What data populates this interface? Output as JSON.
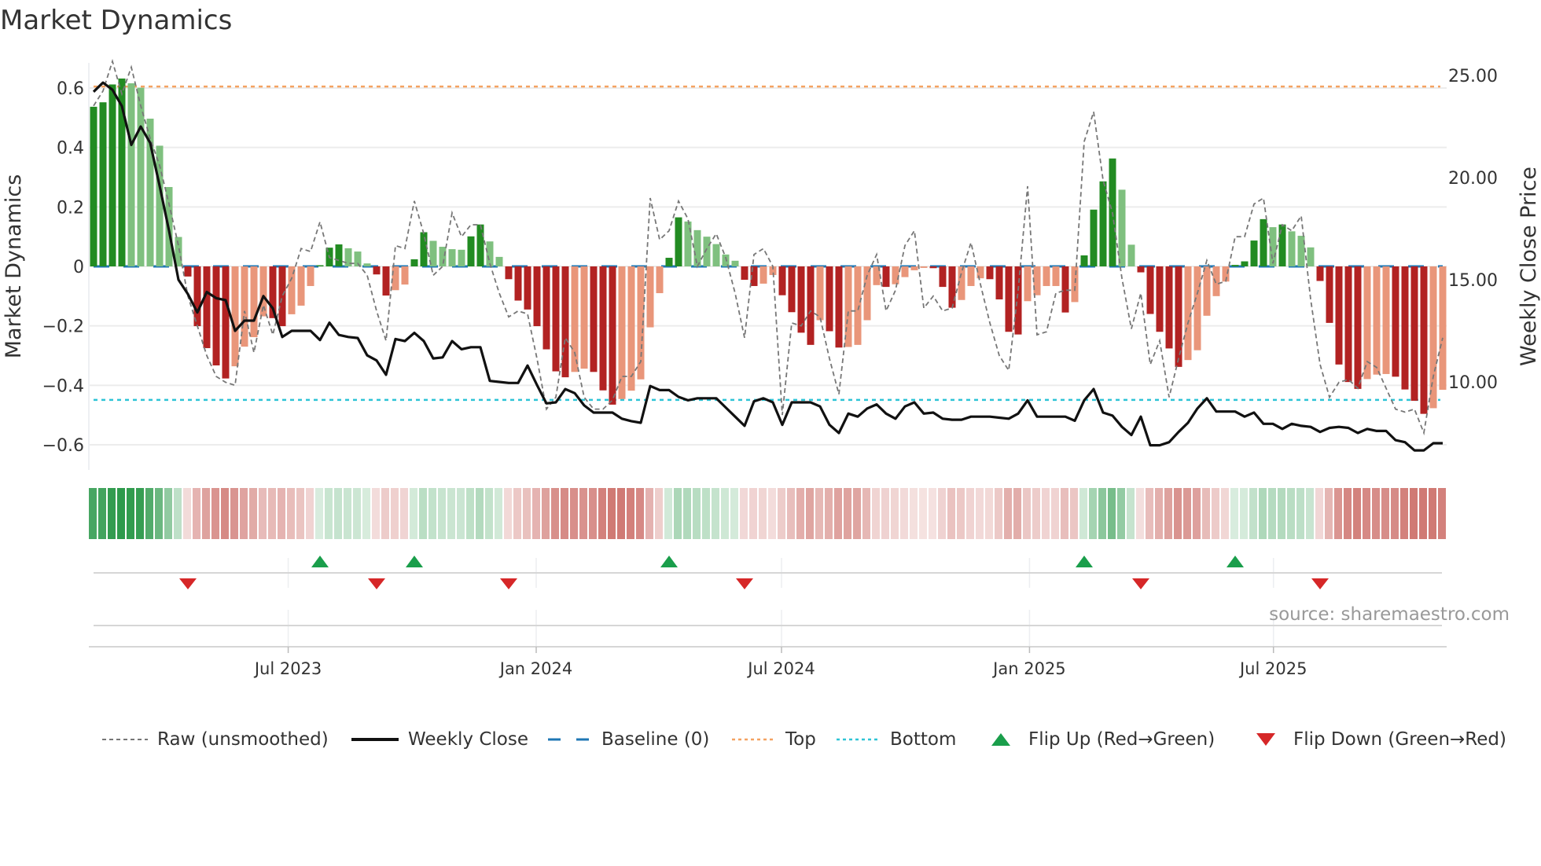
{
  "title": "Market Dynamics",
  "source": "source: sharemaestro.com",
  "legend": {
    "raw": "Raw (unsmoothed)",
    "close": "Weekly Close",
    "baseline": "Baseline (0)",
    "top": "Top",
    "bottom": "Bottom",
    "flip_up": "Flip Up (Red→Green)",
    "flip_down": "Flip Down (Green→Red)"
  },
  "colors": {
    "strong_up": "#228b22",
    "weak_up": "#7fc07f",
    "strong_down": "#b22222",
    "weak_down": "#e9967a",
    "close": "#111111",
    "raw": "#777777",
    "baseline": "#1f77b4",
    "top": "#f4a261",
    "bottom": "#2ec4d6",
    "flip_up": "#1a9e4b",
    "flip_down": "#d62728",
    "heat_green": "#2e9a4c",
    "heat_red": "#c8625c"
  },
  "chart_data": {
    "type": "bar+line",
    "title": "Market Dynamics",
    "ylabel": "Market Dynamics",
    "y2label": "Weekly Close Price",
    "ylim": [
      -0.7,
      0.7
    ],
    "y2lim": [
      5.5,
      26.3
    ],
    "yticks": [
      {
        "v": 0.6,
        "label": "0.6"
      },
      {
        "v": 0.4,
        "label": "0.4"
      },
      {
        "v": 0.2,
        "label": "0.2"
      },
      {
        "v": 0,
        "label": "0"
      },
      {
        "v": -0.2,
        "label": "−0.2"
      },
      {
        "v": -0.4,
        "label": "−0.4"
      },
      {
        "v": -0.6,
        "label": "−0.6"
      }
    ],
    "y2ticks": [
      {
        "v": 25,
        "label": "25.00"
      },
      {
        "v": 20,
        "label": "20.00"
      },
      {
        "v": 15,
        "label": "15.00"
      },
      {
        "v": 10,
        "label": "10.00"
      }
    ],
    "xticks": [
      {
        "date": "2023-07-01",
        "label": "Jul 2023"
      },
      {
        "date": "2024-01-01",
        "label": "Jan 2024"
      },
      {
        "date": "2024-07-01",
        "label": "Jul 2024"
      },
      {
        "date": "2025-01-01",
        "label": "Jan 2025"
      },
      {
        "date": "2025-07-01",
        "label": "Jul 2025"
      }
    ],
    "start_date": "2023-02-06",
    "frequency": "weekly",
    "top_level": 0.605,
    "bottom_level": -0.449,
    "baseline": 0,
    "bar_states": "GGGGggggggRRRRRrrrrRRrrrGGGgggRRrrGGggggGGggRRRRRRRrrRRRrrrrrGGggggggRRrrRRRRrRRrrrrRrrrrRRRrrrRRRRrrrrRrGGGGggRRRRRrrrrrGGGGgGgggRRRRRrrrRRRRrr",
    "values": [
      0.537,
      0.552,
      0.612,
      0.632,
      0.616,
      0.601,
      0.497,
      0.406,
      0.267,
      0.099,
      -0.034,
      -0.201,
      -0.275,
      -0.333,
      -0.377,
      -0.336,
      -0.27,
      -0.238,
      -0.168,
      -0.174,
      -0.201,
      -0.161,
      -0.132,
      -0.066,
      0.004,
      0.063,
      0.074,
      0.061,
      0.05,
      0.01,
      -0.027,
      -0.098,
      -0.08,
      -0.061,
      0.024,
      0.115,
      0.086,
      0.066,
      0.058,
      0.056,
      0.101,
      0.141,
      0.084,
      0.032,
      -0.043,
      -0.115,
      -0.145,
      -0.201,
      -0.279,
      -0.353,
      -0.373,
      -0.355,
      -0.344,
      -0.355,
      -0.417,
      -0.465,
      -0.446,
      -0.418,
      -0.38,
      -0.205,
      -0.09,
      0.029,
      0.165,
      0.151,
      0.122,
      0.1,
      0.075,
      0.04,
      0.019,
      -0.045,
      -0.066,
      -0.058,
      -0.029,
      -0.097,
      -0.154,
      -0.223,
      -0.264,
      -0.181,
      -0.218,
      -0.273,
      -0.271,
      -0.264,
      -0.181,
      -0.063,
      -0.069,
      -0.06,
      -0.036,
      -0.013,
      -0.005,
      -0.006,
      -0.069,
      -0.139,
      -0.113,
      -0.066,
      -0.04,
      -0.043,
      -0.111,
      -0.22,
      -0.229,
      -0.117,
      -0.097,
      -0.066,
      -0.066,
      -0.155,
      -0.12,
      0.037,
      0.191,
      0.286,
      0.363,
      0.258,
      0.073,
      -0.02,
      -0.16,
      -0.22,
      -0.276,
      -0.338,
      -0.315,
      -0.282,
      -0.166,
      -0.1,
      -0.051,
      0.005,
      0.017,
      0.087,
      0.159,
      0.132,
      0.141,
      0.118,
      0.103,
      0.064,
      -0.049,
      -0.19,
      -0.33,
      -0.389,
      -0.412,
      -0.379,
      -0.364,
      -0.362,
      -0.371,
      -0.414,
      -0.452,
      -0.496,
      -0.477,
      -0.415
    ],
    "raw": [
      0.54,
      0.59,
      0.69,
      0.58,
      0.67,
      0.54,
      0.43,
      0.34,
      0.21,
      0.07,
      -0.1,
      -0.2,
      -0.3,
      -0.37,
      -0.39,
      -0.4,
      -0.15,
      -0.29,
      -0.13,
      -0.23,
      -0.1,
      -0.04,
      0.06,
      0.05,
      0.15,
      0.03,
      0.02,
      0.01,
      0.01,
      -0.03,
      -0.15,
      -0.25,
      0.07,
      0.06,
      0.22,
      0.11,
      -0.03,
      0.0,
      0.18,
      0.1,
      0.14,
      0.14,
      0.01,
      -0.09,
      -0.17,
      -0.15,
      -0.16,
      -0.31,
      -0.48,
      -0.44,
      -0.24,
      -0.29,
      -0.44,
      -0.48,
      -0.48,
      -0.45,
      -0.37,
      -0.37,
      -0.32,
      0.23,
      0.09,
      0.12,
      0.22,
      0.16,
      0.0,
      0.06,
      0.11,
      0.03,
      -0.09,
      -0.24,
      0.04,
      0.06,
      0.0,
      -0.5,
      -0.19,
      -0.2,
      -0.15,
      -0.17,
      -0.31,
      -0.43,
      -0.15,
      -0.15,
      -0.03,
      0.04,
      -0.15,
      -0.08,
      0.07,
      0.12,
      -0.14,
      -0.1,
      -0.15,
      -0.14,
      -0.02,
      0.08,
      -0.06,
      -0.19,
      -0.3,
      -0.35,
      -0.08,
      0.27,
      -0.23,
      -0.22,
      -0.09,
      -0.08,
      -0.08,
      0.42,
      0.52,
      0.29,
      0.18,
      -0.04,
      -0.21,
      -0.09,
      -0.33,
      -0.25,
      -0.44,
      -0.31,
      -0.19,
      -0.09,
      0.02,
      -0.06,
      -0.05,
      0.1,
      0.1,
      0.21,
      0.23,
      0.01,
      0.14,
      0.12,
      0.17,
      -0.11,
      -0.33,
      -0.44,
      -0.39,
      -0.38,
      -0.41,
      -0.32,
      -0.34,
      -0.41,
      -0.48,
      -0.49,
      -0.48,
      -0.56,
      -0.37,
      -0.24
    ],
    "close": [
      24.2,
      24.65,
      24.3,
      23.5,
      21.6,
      22.5,
      21.7,
      19.6,
      17.4,
      15.0,
      14.3,
      13.4,
      14.4,
      14.1,
      14.0,
      12.5,
      13.0,
      13.0,
      14.2,
      13.6,
      12.2,
      12.5,
      12.5,
      12.5,
      12.05,
      12.9,
      12.3,
      12.2,
      12.15,
      11.3,
      11.05,
      10.35,
      12.1,
      12.0,
      12.4,
      12.0,
      11.15,
      11.2,
      12.0,
      11.6,
      11.7,
      11.7,
      10.05,
      10.0,
      9.95,
      9.95,
      10.8,
      9.85,
      8.95,
      9.0,
      9.65,
      9.45,
      8.85,
      8.5,
      8.5,
      8.5,
      8.2,
      8.08,
      8.0,
      9.8,
      9.6,
      9.6,
      9.27,
      9.1,
      9.2,
      9.2,
      9.2,
      8.75,
      8.3,
      7.85,
      9.05,
      9.2,
      9.0,
      7.9,
      9.0,
      9.0,
      9.0,
      8.8,
      7.9,
      7.5,
      8.45,
      8.3,
      8.7,
      8.9,
      8.45,
      8.2,
      8.8,
      9.0,
      8.45,
      8.5,
      8.2,
      8.15,
      8.15,
      8.3,
      8.3,
      8.3,
      8.25,
      8.2,
      8.45,
      9.1,
      8.3,
      8.3,
      8.3,
      8.3,
      8.1,
      9.1,
      9.65,
      8.5,
      8.35,
      7.8,
      7.4,
      8.3,
      6.9,
      6.9,
      7.05,
      7.55,
      8.0,
      8.7,
      9.2,
      8.55,
      8.55,
      8.55,
      8.3,
      8.5,
      7.95,
      7.95,
      7.7,
      7.95,
      7.85,
      7.8,
      7.55,
      7.75,
      7.8,
      7.75,
      7.5,
      7.7,
      7.6,
      7.6,
      7.15,
      7.05,
      6.65,
      6.65,
      7.0,
      7.0
    ],
    "grid": true,
    "legend_position": "bottom"
  }
}
